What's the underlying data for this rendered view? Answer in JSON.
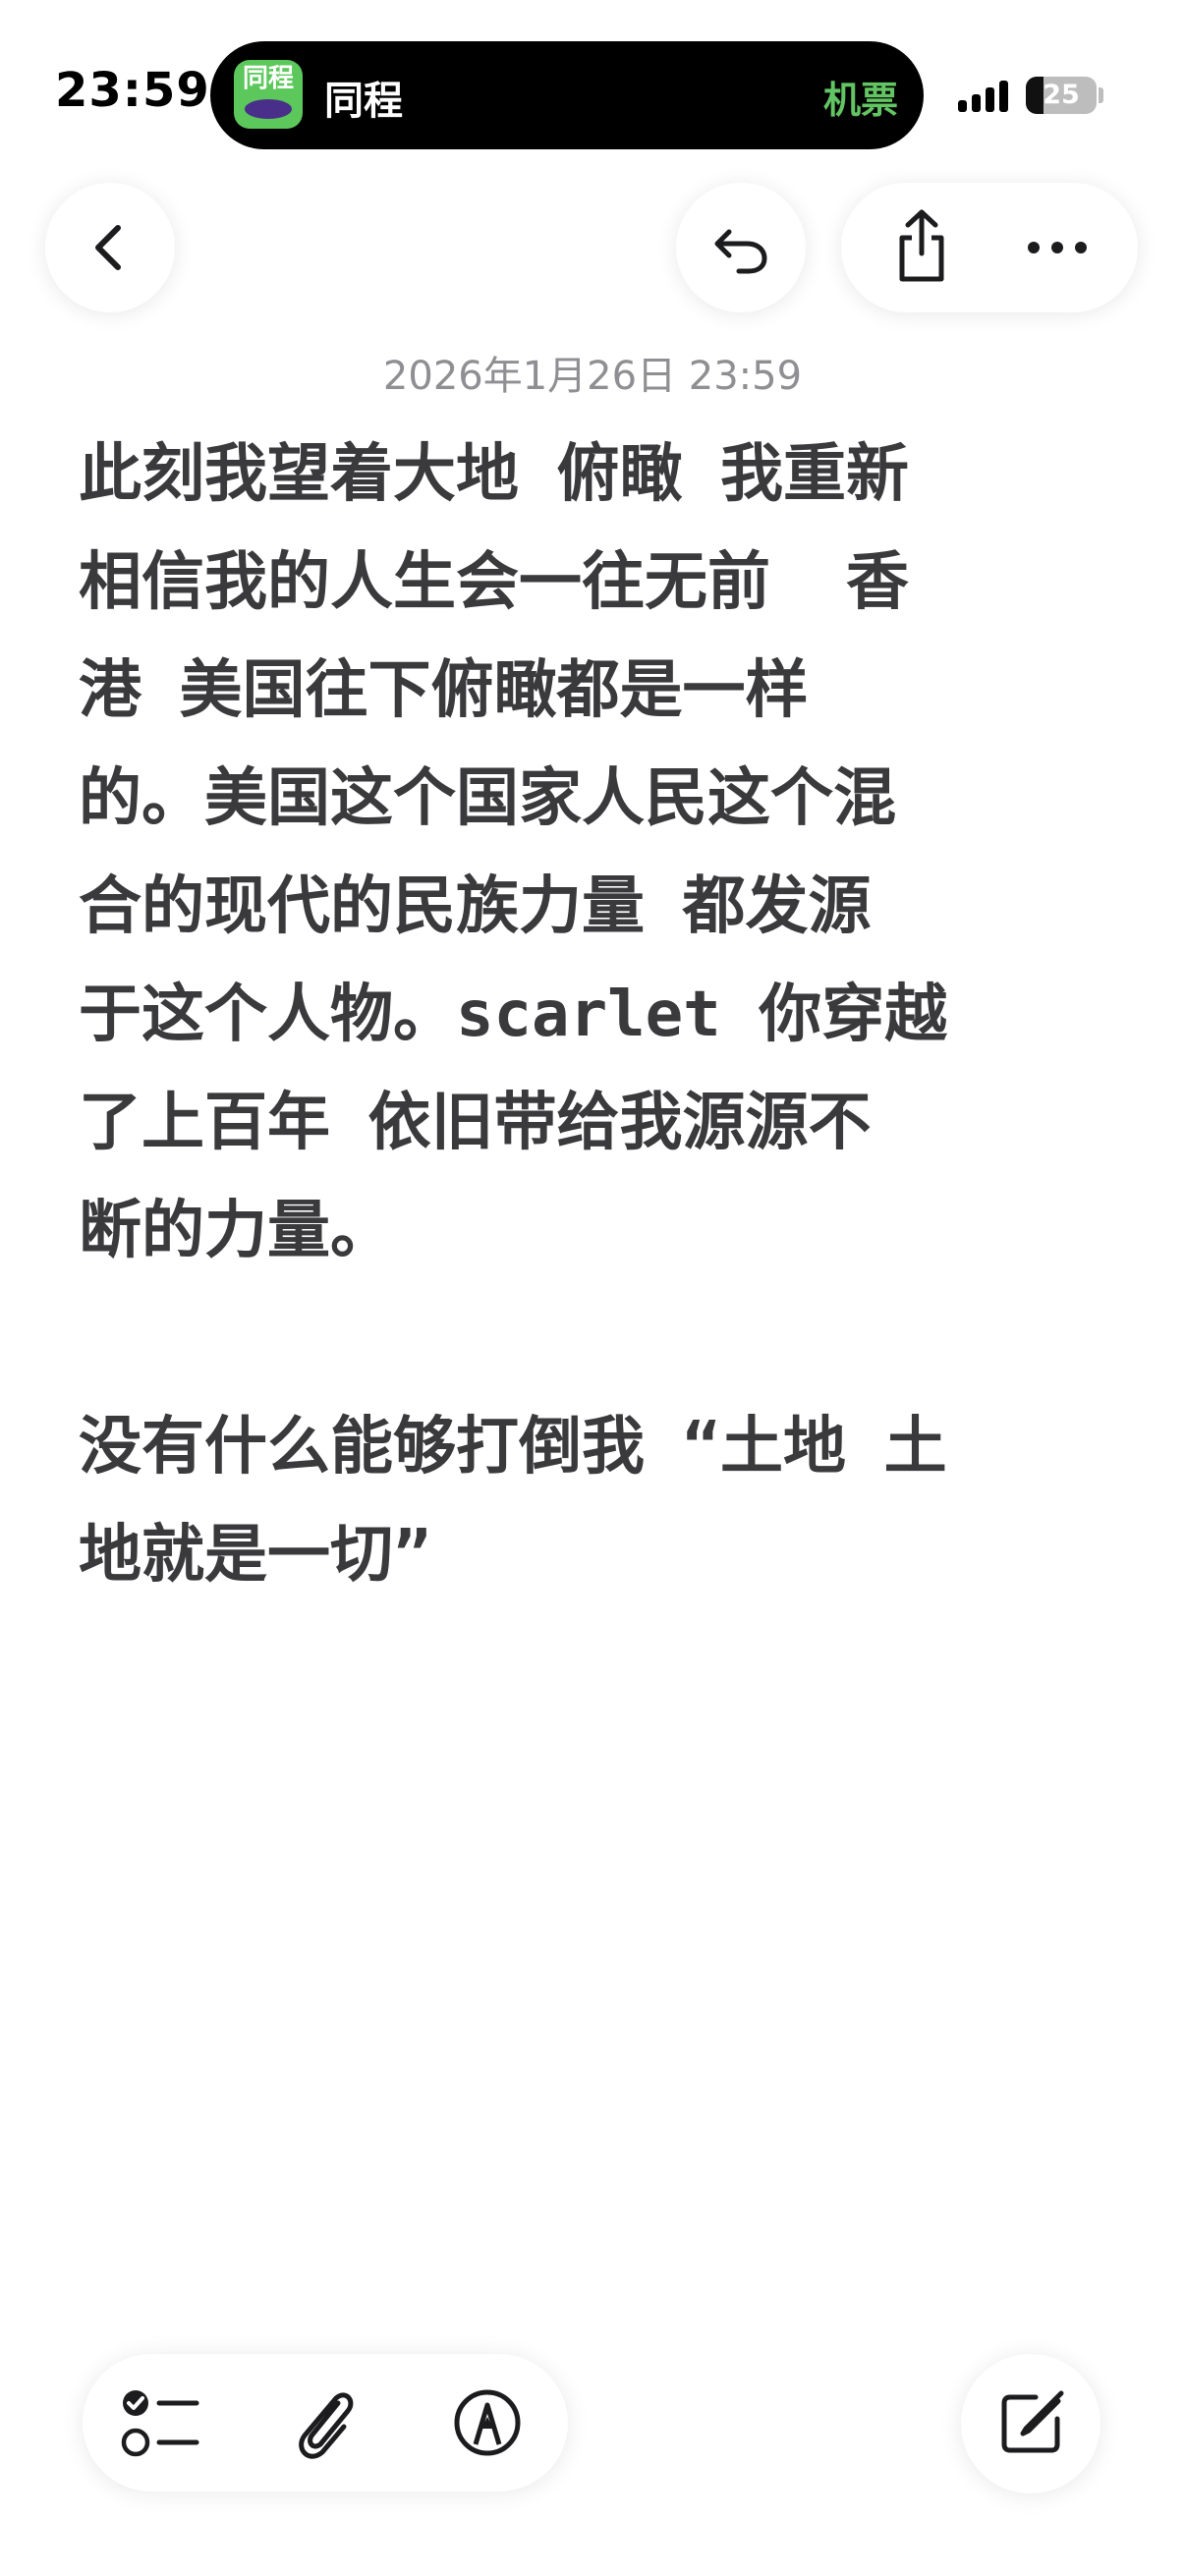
{
  "status_bar": {
    "time": "23:59",
    "battery_percent": "25",
    "battery_level": 0.25
  },
  "live_activity": {
    "app_icon_text": "同程",
    "app_name": "同程",
    "activity_label": "机票",
    "accent_color": "#63c463"
  },
  "toolbar": {
    "back_icon": "chevron-left-icon",
    "undo_icon": "undo-icon",
    "share_icon": "share-icon",
    "more_icon": "ellipsis-icon"
  },
  "note": {
    "timestamp": "2026年1月26日 23:59",
    "body": "此刻我望着大地 俯瞰 我重新\n相信我的人生会一往无前  香\n港 美国往下俯瞰都是一样\n的。美国这个国家人民这个混\n合的现代的民族力量 都发源\n于这个人物。scarlet 你穿越\n了上百年 依旧带给我源源不\n断的力量。\n\n没有什么能够打倒我 “土地 土\n地就是一切”"
  },
  "bottom_toolbar": {
    "checklist_icon": "checklist-icon",
    "attachment_icon": "paperclip-icon",
    "markup_icon": "pen-markup-icon",
    "compose_icon": "compose-icon"
  }
}
